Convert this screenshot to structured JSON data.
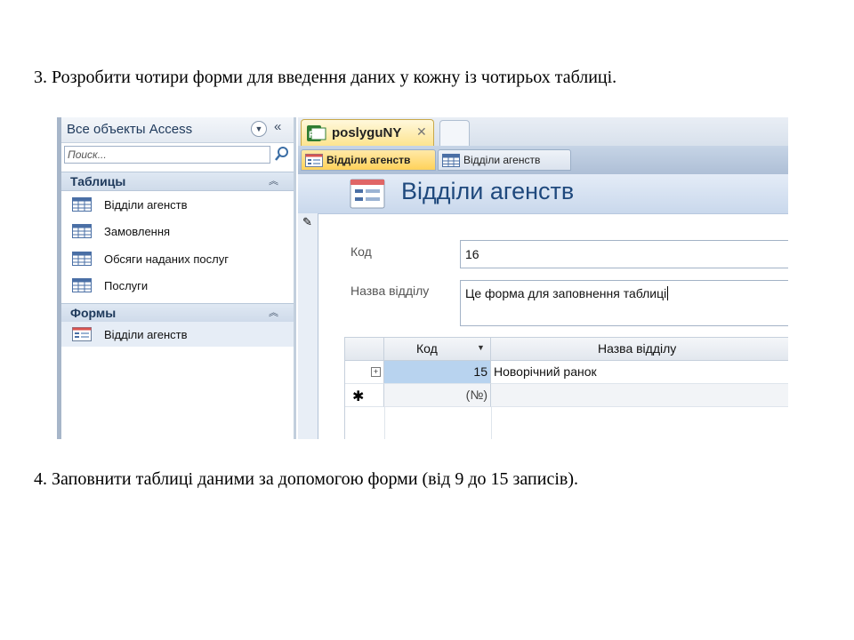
{
  "instructions": {
    "step3": "3. Розробити чотири форми для введення даних у  кожну із чотирьох  таблиці.",
    "step4": "4. Заповнити таблиці даними за допомогою форми (від 9 до 15 записів)."
  },
  "nav_pane": {
    "title": "Все объекты Access",
    "search_placeholder": "Поиск...",
    "groups": {
      "tables": {
        "label": "Таблицы",
        "items": [
          "Відділи агенств",
          "Замовлення",
          "Обсяги наданих послуг",
          "Послуги"
        ]
      },
      "forms": {
        "label": "Формы",
        "items": [
          "Відділи агенств"
        ]
      }
    }
  },
  "document": {
    "file_tab": {
      "label": "poslyguNY",
      "close": "✕"
    },
    "object_tabs": [
      {
        "label": "Відділи агенств",
        "type": "form",
        "active": true
      },
      {
        "label": "Відділи агенств",
        "type": "table",
        "active": false
      }
    ],
    "form": {
      "title": "Відділи агенств",
      "fields": {
        "kod": {
          "label": "Код",
          "value": "16"
        },
        "nazva": {
          "label": "Назва відділу",
          "value": "Це форма для заповнення таблиці"
        }
      },
      "subform": {
        "columns": [
          "Код",
          "Назва відділу"
        ],
        "rows": [
          {
            "kod": "15",
            "nazva": "Новорічний ранок"
          }
        ],
        "new_row": {
          "kod": "(№)"
        }
      }
    }
  },
  "colors": {
    "accent_title": "#1f497d",
    "active_tab": "#ffd25a",
    "selected_cell": "#b8d3ef"
  }
}
